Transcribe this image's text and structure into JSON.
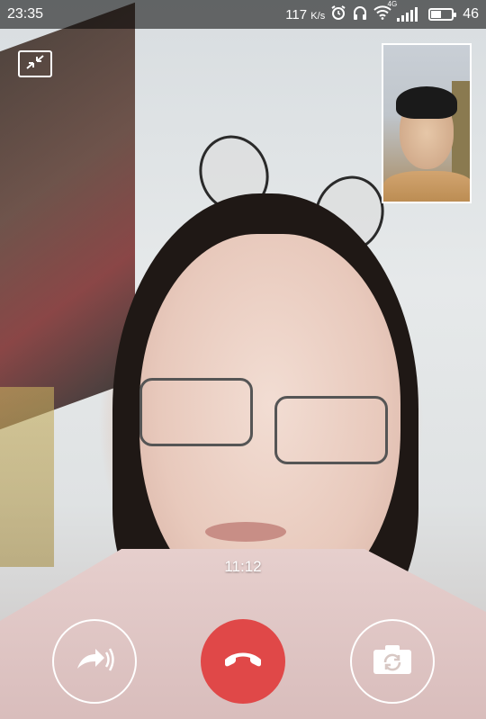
{
  "status_bar": {
    "time": "23:35",
    "net_speed_value": "117",
    "net_speed_unit": "K/s",
    "battery_level": "46",
    "network_type": "4G"
  },
  "call": {
    "duration": "11:12"
  },
  "icons": {
    "minimize": "minimize-arrows-icon",
    "speaker": "speaker-icon",
    "hangup": "phone-hangup-icon",
    "switch_camera": "camera-switch-icon",
    "alarm": "alarm-clock-icon",
    "headphones": "headphones-icon",
    "wifi": "wifi-icon",
    "signal": "cell-signal-icon",
    "battery": "battery-icon"
  },
  "colors": {
    "hangup": "#e04848",
    "status_bar_bg": "rgba(0,0,0,0.55)",
    "icon_stroke": "#ffffff"
  }
}
